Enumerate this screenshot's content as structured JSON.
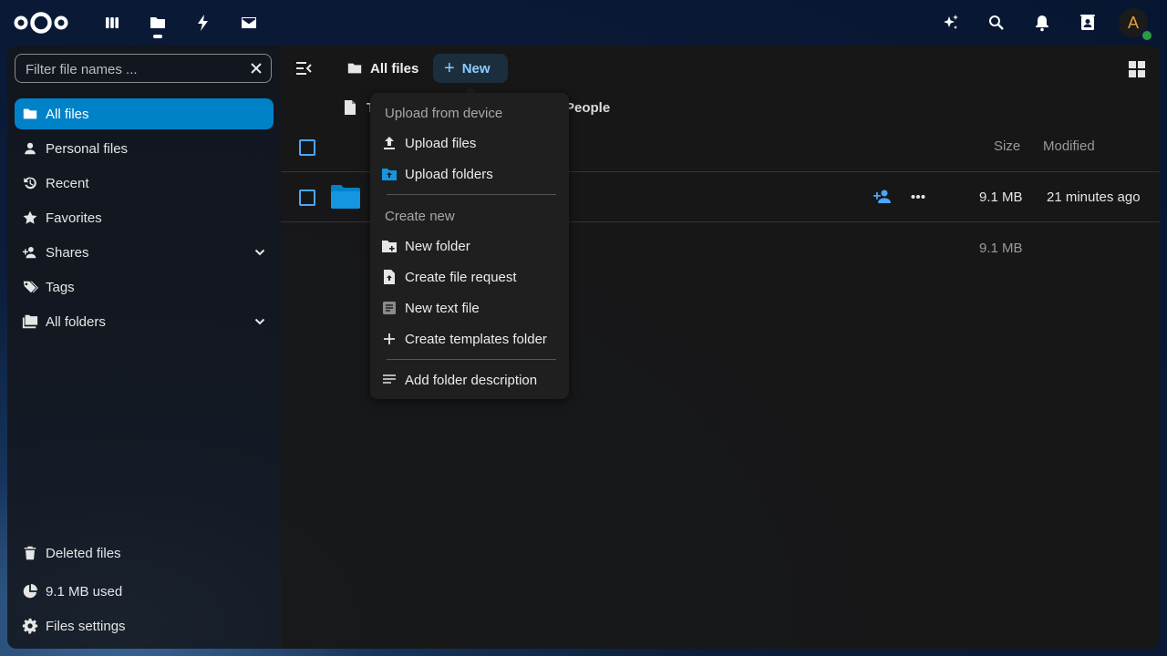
{
  "header": {
    "apps": [
      {
        "name": "dashboard-app-icon"
      },
      {
        "name": "files-app-icon"
      },
      {
        "name": "activity-app-icon"
      },
      {
        "name": "mail-app-icon"
      }
    ],
    "right_icons": [
      {
        "name": "assistant-sparkle-icon"
      },
      {
        "name": "search-icon"
      },
      {
        "name": "notifications-bell-icon"
      },
      {
        "name": "contacts-icon"
      }
    ],
    "avatar_letter": "A",
    "avatar_status_color": "#2d9a45"
  },
  "sidebar": {
    "filter_placeholder": "Filter file names ...",
    "items": [
      {
        "label": "All files",
        "icon": "folder-icon",
        "active": true
      },
      {
        "label": "Personal files",
        "icon": "person-icon"
      },
      {
        "label": "Recent",
        "icon": "history-icon"
      },
      {
        "label": "Favorites",
        "icon": "star-icon"
      },
      {
        "label": "Shares",
        "icon": "share-person-icon"
      },
      {
        "label": "Tags",
        "icon": "tag-icon"
      },
      {
        "label": "All folders",
        "icon": "folders-icon"
      }
    ],
    "footer": {
      "deleted": "Deleted files",
      "quota": "9.1 MB used",
      "settings": "Files settings"
    },
    "accent": "#0082c9"
  },
  "main": {
    "breadcrumb": "All files",
    "new_button": "New",
    "template_row": {
      "left_char": "T",
      "right_text": "People"
    },
    "columns": {
      "size": "Size",
      "modified": "Modified"
    },
    "rows": [
      {
        "size": "9.1 MB",
        "modified": "21 minutes ago"
      }
    ],
    "total_size": "9.1 MB"
  },
  "menu": {
    "section_upload": "Upload from device",
    "upload_files": "Upload files",
    "upload_folders": "Upload folders",
    "section_create": "Create new",
    "new_folder": "New folder",
    "create_file_request": "Create file request",
    "new_text_file": "New text file",
    "create_templates_folder": "Create templates folder",
    "add_folder_description": "Add folder description"
  }
}
